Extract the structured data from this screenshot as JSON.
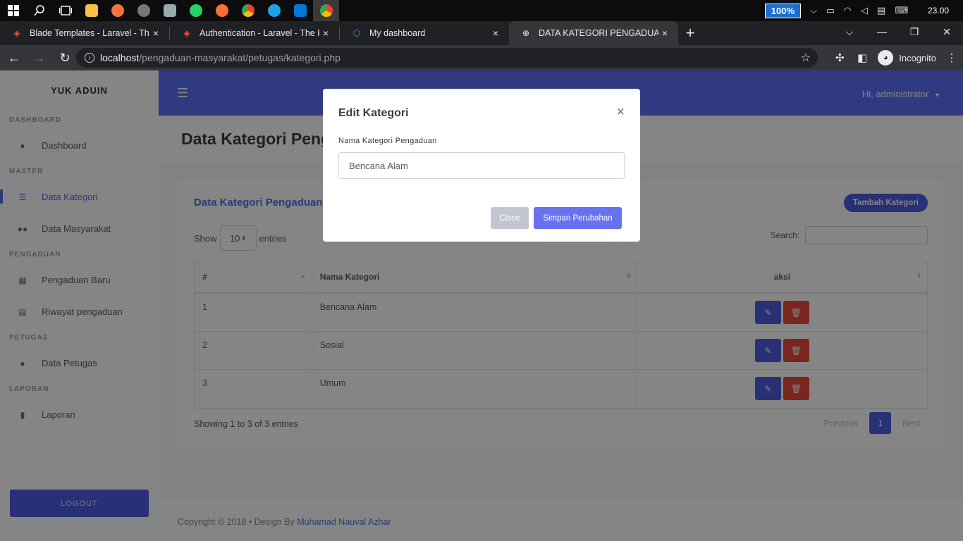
{
  "taskbar": {
    "zoom": "100%",
    "clock": "23.00"
  },
  "browser": {
    "tabs": [
      {
        "title": "Blade Templates - Laravel - The P",
        "close": "×",
        "favicon_color": "#f05340"
      },
      {
        "title": "Authentication - Laravel - The PH",
        "close": "×",
        "favicon_color": "#f05340"
      },
      {
        "title": "My dashboard",
        "close": "×",
        "favicon_color": "#4d8ef8"
      },
      {
        "title": "DATA KATEGORI PENGADUAN",
        "close": "×",
        "favicon_color": "#e8eaed"
      }
    ],
    "new_tab": "+",
    "url_host": "localhost",
    "url_path": "/pengaduan-masyarakat/petugas/kategori.php",
    "profile_label": "Incognito"
  },
  "sidebar": {
    "brand": "YUK ADUIN",
    "sections": [
      {
        "heading": "DASHBOARD",
        "items": [
          {
            "label": "Dashboard",
            "icon": "fire-icon"
          }
        ]
      },
      {
        "heading": "MASTER",
        "items": [
          {
            "label": "Data Kategori",
            "icon": "list-icon"
          },
          {
            "label": "Data Masyarakat",
            "icon": "users-icon"
          }
        ]
      },
      {
        "heading": "PENGADUAN",
        "items": [
          {
            "label": "Pengaduan Baru",
            "icon": "grid-icon"
          },
          {
            "label": "Riwayat pengaduan",
            "icon": "table-icon"
          }
        ]
      },
      {
        "heading": "PETUGAS",
        "items": [
          {
            "label": "Data Petugas",
            "icon": "user-icon"
          }
        ]
      },
      {
        "heading": "LAPORAN",
        "items": [
          {
            "label": "Laporan",
            "icon": "file-icon"
          }
        ]
      }
    ],
    "logout": "LOGOUT"
  },
  "topnav": {
    "user_greeting": "Hi, administrator"
  },
  "page": {
    "title": "Data Kategori Pengaduan"
  },
  "card": {
    "title": "Data Kategori Pengaduan",
    "add_button": "Tambah Kategori",
    "show_label": "Show",
    "entries_value": "10",
    "entries_label": "entries",
    "search_label": "Search:",
    "columns": [
      "#",
      "Nama Kategori",
      "aksi"
    ],
    "rows": [
      {
        "no": "1",
        "nama": "Bencana Alam"
      },
      {
        "no": "2",
        "nama": "Sosial"
      },
      {
        "no": "3",
        "nama": "Umum"
      }
    ],
    "info": "Showing 1 to 3 of 3 entries",
    "pager": {
      "previous": "Previous",
      "current": "1",
      "next": "Next"
    }
  },
  "footer": {
    "copyright": "Copyright © 2018  •  Design By ",
    "author": "Muhamad Nauval Azhar"
  },
  "modal": {
    "title": "Edit Kategori",
    "close_icon": "×",
    "label": "Nama Kategori Pengaduan",
    "input_value": "Bencana Alam",
    "close_button": "Close",
    "save_button": "Simpan Perubahan"
  },
  "colors": {
    "primary": "#4e5ee0",
    "topnav": "#5b6ff7",
    "danger": "#e74a3b"
  }
}
